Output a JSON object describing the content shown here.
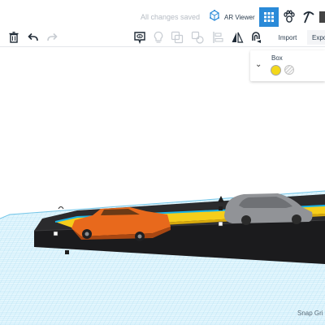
{
  "header": {
    "save_status": "All changes saved",
    "ar_viewer_label": "AR Viewer",
    "icons": [
      "ar-cube-icon",
      "grid-view-icon",
      "pet-icon",
      "pickaxe-icon"
    ]
  },
  "toolbar": {
    "icons": [
      "trash-icon",
      "undo-icon",
      "redo-icon",
      "note-icon",
      "light-bulb-icon",
      "group-icon",
      "ungroup-icon",
      "align-icon",
      "mirror-icon",
      "cruise-icon"
    ],
    "import_label": "Import",
    "export_label": "Expo"
  },
  "inspector": {
    "title": "Box",
    "solid_color": "#f3d81a",
    "hole_option": "hole-swatch"
  },
  "workplane": {
    "snap_grid_label": "Snap Gri"
  },
  "colors": {
    "accent": "#2a8ad8",
    "grid": "#a8dcef",
    "platform": "#1e1e20",
    "strip": "#f5cd18",
    "car_orange": "#e8691c",
    "car_gray": "#8f9195"
  }
}
